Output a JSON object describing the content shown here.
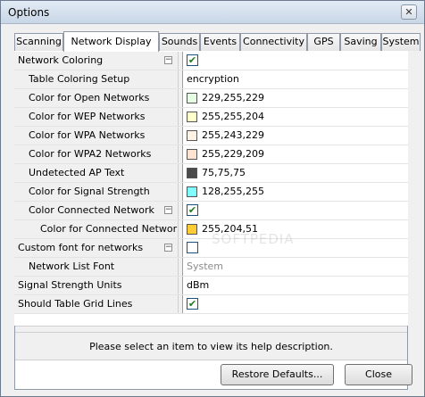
{
  "window": {
    "title": "Options",
    "close_glyph": "✕"
  },
  "tabs": [
    {
      "label": "Scanning"
    },
    {
      "label": "Network Display",
      "active": true
    },
    {
      "label": "Sounds"
    },
    {
      "label": "Events"
    },
    {
      "label": "Connectivity"
    },
    {
      "label": "GPS"
    },
    {
      "label": "Saving"
    },
    {
      "label": "System"
    }
  ],
  "grid": {
    "rows": [
      {
        "label": "Network Coloring",
        "expand": "−",
        "type": "checkbox",
        "checked": "✔"
      },
      {
        "label": "Table Coloring Setup",
        "type": "text",
        "value": "encryption"
      },
      {
        "label": "Color for Open Networks",
        "type": "color",
        "value": "229,255,229",
        "color": "#e5ffe5"
      },
      {
        "label": "Color for WEP Networks",
        "type": "color",
        "value": "255,255,204",
        "color": "#ffffcc"
      },
      {
        "label": "Color for WPA Networks",
        "type": "color",
        "value": "255,243,229",
        "color": "#fff3e5"
      },
      {
        "label": "Color for WPA2 Networks",
        "type": "color",
        "value": "255,229,209",
        "color": "#ffe5d1"
      },
      {
        "label": "Undetected AP Text",
        "type": "color",
        "value": "75,75,75",
        "color": "#4b4b4b"
      },
      {
        "label": "Color for Signal Strength",
        "type": "color",
        "value": "128,255,255",
        "color": "#80ffff"
      },
      {
        "label": "Color Connected Network",
        "expand": "−",
        "type": "checkbox",
        "checked": "✔"
      },
      {
        "label": "Color for Connected Network",
        "type": "color",
        "value": "255,204,51",
        "color": "#ffcc33"
      },
      {
        "label": "Custom font for networks",
        "expand": "−",
        "type": "checkbox",
        "checked": ""
      },
      {
        "label": "Network List Font",
        "type": "text-disabled",
        "value": "System"
      },
      {
        "label": "Signal Strength Units",
        "type": "text",
        "value": "dBm"
      },
      {
        "label": "Should Table Grid Lines",
        "type": "checkbox",
        "checked": "✔"
      }
    ]
  },
  "help": {
    "text": "Please select an item to view its help description."
  },
  "buttons": {
    "restore": "Restore Defaults...",
    "close": "Close"
  },
  "watermark": "SOFTPEDIA"
}
